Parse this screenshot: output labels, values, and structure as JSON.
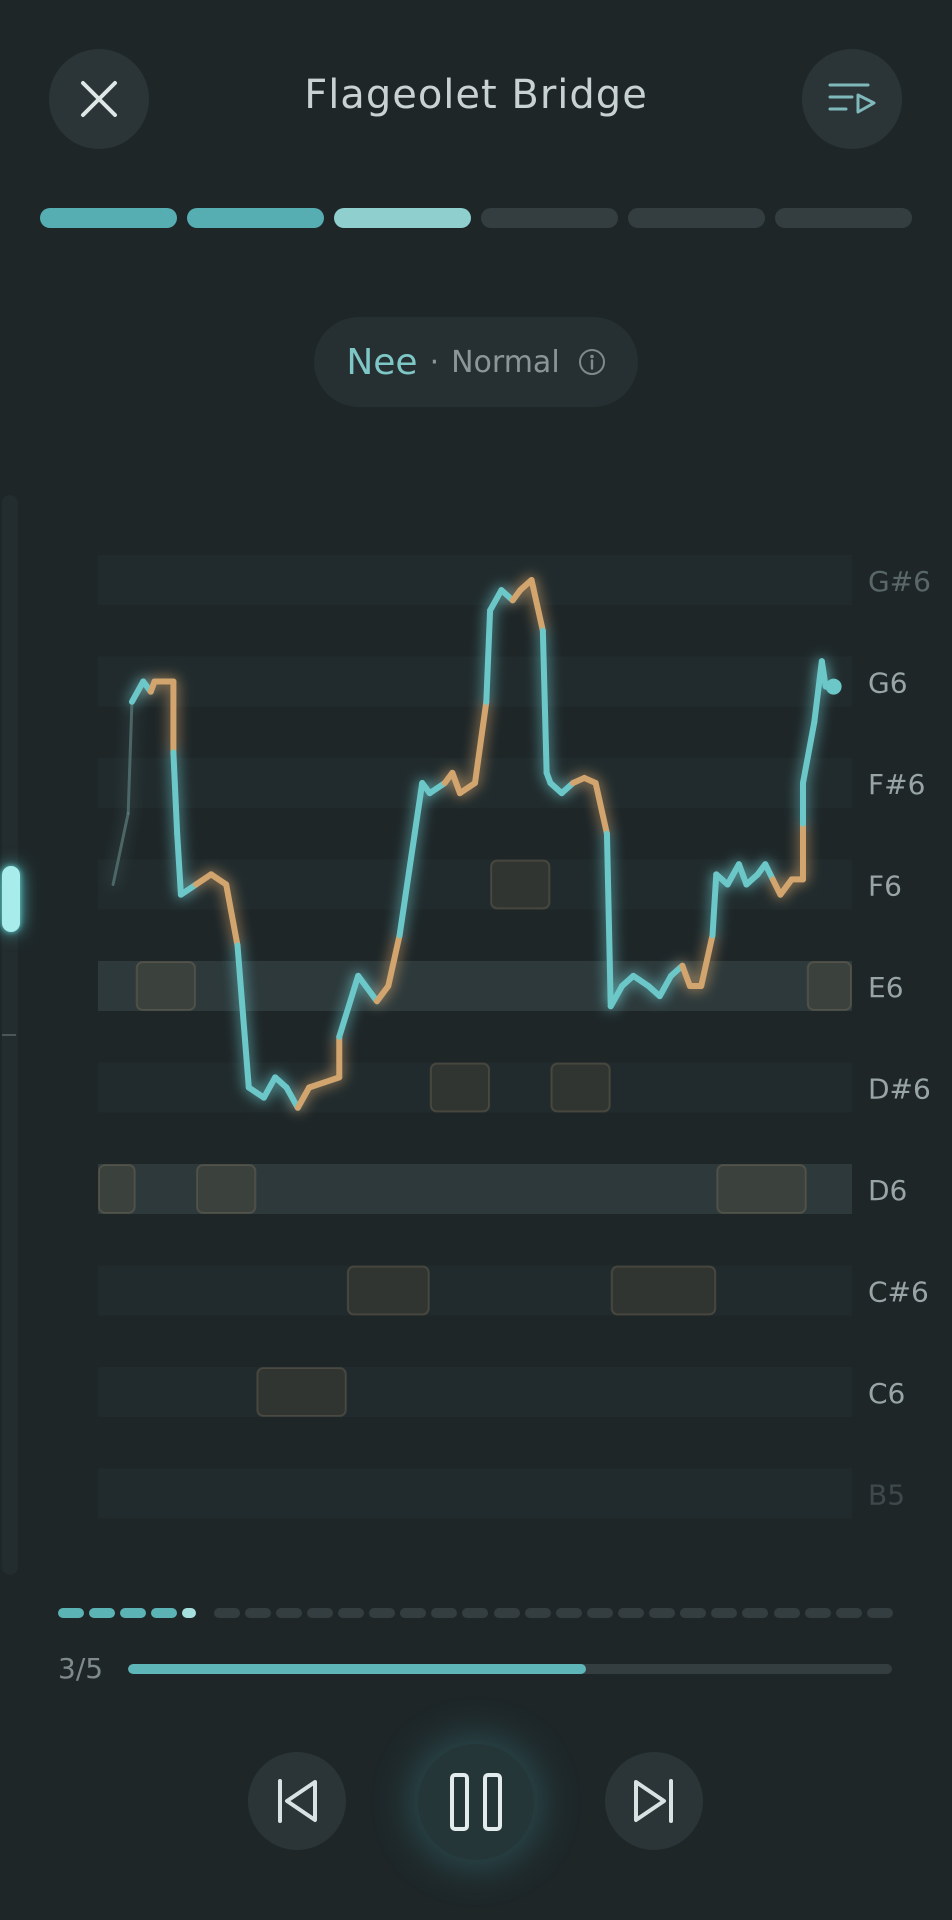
{
  "header": {
    "title": "Flageolet Bridge",
    "close_icon": "close-icon",
    "playlist_icon": "playlist-play-icon"
  },
  "steps": {
    "total": 6,
    "completed": 2,
    "current": 3
  },
  "exercise": {
    "syllable": "Nee",
    "separator": "·",
    "mode": "Normal",
    "info_icon": "info-icon"
  },
  "pitch_chart": {
    "notes": [
      "G#6",
      "G6",
      "F#6",
      "F6",
      "E6",
      "D#6",
      "D6",
      "C#6",
      "C6",
      "B5"
    ],
    "highlighted_notes": [
      "E6",
      "D6"
    ],
    "colors": {
      "on_pitch": "#6cc7c9",
      "off_pitch": "#d2a46e",
      "lane": "#252f31",
      "highlight": "#2d393b"
    }
  },
  "chart_data": {
    "type": "line",
    "xlabel": "",
    "ylabel": "",
    "y_notes_high_to_low": [
      "G#6",
      "G6",
      "F#6",
      "F6",
      "E6",
      "D#6",
      "D6",
      "C#6",
      "C6",
      "B5"
    ],
    "target_notes": [
      {
        "note": "D6",
        "start": 0.0,
        "end": 0.05
      },
      {
        "note": "E6",
        "start": 0.05,
        "end": 0.13
      },
      {
        "note": "D6",
        "start": 0.13,
        "end": 0.21
      },
      {
        "note": "C6",
        "start": 0.21,
        "end": 0.33
      },
      {
        "note": "C#6",
        "start": 0.33,
        "end": 0.44
      },
      {
        "note": "D#6",
        "start": 0.44,
        "end": 0.52
      },
      {
        "note": "F6",
        "start": 0.52,
        "end": 0.6
      },
      {
        "note": "D#6",
        "start": 0.6,
        "end": 0.68
      },
      {
        "note": "C#6",
        "start": 0.68,
        "end": 0.82
      },
      {
        "note": "D6",
        "start": 0.82,
        "end": 0.94
      },
      {
        "note": "E6",
        "start": 0.94,
        "end": 1.0
      }
    ],
    "sung_pitch": [
      {
        "t": 0.02,
        "n": 6.0,
        "s": "faint"
      },
      {
        "t": 0.04,
        "n": 6.7,
        "s": "faint"
      },
      {
        "t": 0.045,
        "n": 7.8,
        "s": "faint"
      },
      {
        "t": 0.06,
        "n": 8.0,
        "s": "on"
      },
      {
        "t": 0.07,
        "n": 7.9,
        "s": "on"
      },
      {
        "t": 0.075,
        "n": 8.0,
        "s": "off"
      },
      {
        "t": 0.1,
        "n": 8.0,
        "s": "off"
      },
      {
        "t": 0.1,
        "n": 7.3,
        "s": "off"
      },
      {
        "t": 0.105,
        "n": 6.5,
        "s": "on"
      },
      {
        "t": 0.11,
        "n": 5.9,
        "s": "on"
      },
      {
        "t": 0.13,
        "n": 6.0,
        "s": "on"
      },
      {
        "t": 0.15,
        "n": 6.1,
        "s": "off"
      },
      {
        "t": 0.17,
        "n": 6.0,
        "s": "off"
      },
      {
        "t": 0.185,
        "n": 5.4,
        "s": "off"
      },
      {
        "t": 0.2,
        "n": 4.0,
        "s": "on"
      },
      {
        "t": 0.22,
        "n": 3.9,
        "s": "on"
      },
      {
        "t": 0.235,
        "n": 4.1,
        "s": "on"
      },
      {
        "t": 0.25,
        "n": 4.0,
        "s": "on"
      },
      {
        "t": 0.265,
        "n": 3.8,
        "s": "on"
      },
      {
        "t": 0.28,
        "n": 4.0,
        "s": "off"
      },
      {
        "t": 0.3,
        "n": 4.05,
        "s": "off"
      },
      {
        "t": 0.32,
        "n": 4.1,
        "s": "off"
      },
      {
        "t": 0.32,
        "n": 4.5,
        "s": "off"
      },
      {
        "t": 0.345,
        "n": 5.1,
        "s": "on"
      },
      {
        "t": 0.355,
        "n": 5.0,
        "s": "on"
      },
      {
        "t": 0.37,
        "n": 4.85,
        "s": "on"
      },
      {
        "t": 0.385,
        "n": 5.0,
        "s": "off"
      },
      {
        "t": 0.4,
        "n": 5.5,
        "s": "off"
      },
      {
        "t": 0.42,
        "n": 6.5,
        "s": "on"
      },
      {
        "t": 0.43,
        "n": 7.0,
        "s": "on"
      },
      {
        "t": 0.44,
        "n": 6.9,
        "s": "on"
      },
      {
        "t": 0.46,
        "n": 7.0,
        "s": "on"
      },
      {
        "t": 0.47,
        "n": 7.1,
        "s": "off"
      },
      {
        "t": 0.48,
        "n": 6.9,
        "s": "off"
      },
      {
        "t": 0.5,
        "n": 7.0,
        "s": "off"
      },
      {
        "t": 0.515,
        "n": 7.8,
        "s": "off"
      },
      {
        "t": 0.52,
        "n": 8.7,
        "s": "on"
      },
      {
        "t": 0.535,
        "n": 8.9,
        "s": "on"
      },
      {
        "t": 0.55,
        "n": 8.8,
        "s": "on"
      },
      {
        "t": 0.56,
        "n": 8.9,
        "s": "off"
      },
      {
        "t": 0.575,
        "n": 9.0,
        "s": "off"
      },
      {
        "t": 0.59,
        "n": 8.5,
        "s": "off"
      },
      {
        "t": 0.595,
        "n": 7.1,
        "s": "on"
      },
      {
        "t": 0.6,
        "n": 7.0,
        "s": "on"
      },
      {
        "t": 0.615,
        "n": 6.9,
        "s": "on"
      },
      {
        "t": 0.63,
        "n": 7.0,
        "s": "on"
      },
      {
        "t": 0.645,
        "n": 7.05,
        "s": "off"
      },
      {
        "t": 0.66,
        "n": 7.0,
        "s": "off"
      },
      {
        "t": 0.675,
        "n": 6.5,
        "s": "off"
      },
      {
        "t": 0.68,
        "n": 4.8,
        "s": "on"
      },
      {
        "t": 0.695,
        "n": 5.0,
        "s": "on"
      },
      {
        "t": 0.71,
        "n": 5.1,
        "s": "on"
      },
      {
        "t": 0.73,
        "n": 5.0,
        "s": "on"
      },
      {
        "t": 0.745,
        "n": 4.9,
        "s": "on"
      },
      {
        "t": 0.76,
        "n": 5.1,
        "s": "on"
      },
      {
        "t": 0.775,
        "n": 5.2,
        "s": "on"
      },
      {
        "t": 0.785,
        "n": 5.0,
        "s": "off"
      },
      {
        "t": 0.8,
        "n": 5.0,
        "s": "off"
      },
      {
        "t": 0.815,
        "n": 5.5,
        "s": "off"
      },
      {
        "t": 0.82,
        "n": 6.1,
        "s": "on"
      },
      {
        "t": 0.835,
        "n": 6.0,
        "s": "on"
      },
      {
        "t": 0.85,
        "n": 6.2,
        "s": "on"
      },
      {
        "t": 0.86,
        "n": 6.0,
        "s": "on"
      },
      {
        "t": 0.875,
        "n": 6.1,
        "s": "on"
      },
      {
        "t": 0.885,
        "n": 6.2,
        "s": "on"
      },
      {
        "t": 0.895,
        "n": 6.05,
        "s": "on"
      },
      {
        "t": 0.905,
        "n": 5.9,
        "s": "off"
      },
      {
        "t": 0.92,
        "n": 6.05,
        "s": "off"
      },
      {
        "t": 0.935,
        "n": 6.05,
        "s": "off"
      },
      {
        "t": 0.935,
        "n": 6.6,
        "s": "off"
      },
      {
        "t": 0.935,
        "n": 7.0,
        "s": "on"
      },
      {
        "t": 0.95,
        "n": 7.6,
        "s": "on"
      },
      {
        "t": 0.96,
        "n": 8.2,
        "s": "on"
      },
      {
        "t": 0.965,
        "n": 7.95,
        "s": "on"
      }
    ]
  },
  "progress_dots": {
    "total": 27,
    "completed": 5
  },
  "phrase": {
    "counter": "3/5",
    "progress": 0.6
  },
  "controls": {
    "prev_icon": "skip-previous-icon",
    "pause_icon": "pause-icon",
    "next_icon": "skip-next-icon"
  }
}
